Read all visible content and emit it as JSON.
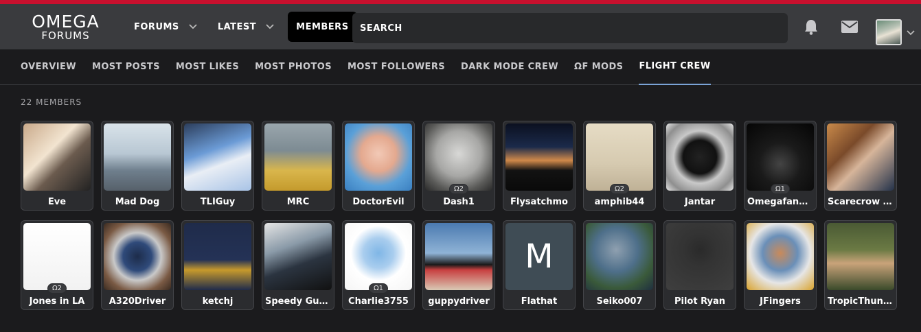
{
  "logo": {
    "line1": "OMEGA",
    "line2": "FORUMS"
  },
  "nav": [
    {
      "label": "FORUMS",
      "dropdown": true
    },
    {
      "label": "LATEST",
      "dropdown": true
    },
    {
      "label": "MEMBERS",
      "dropdown": false,
      "active": true
    }
  ],
  "search": {
    "label": "SEARCH"
  },
  "icons": {
    "notifications": "bell-icon",
    "messages": "envelope-icon"
  },
  "subnav": [
    {
      "label": "OVERVIEW"
    },
    {
      "label": "MOST POSTS"
    },
    {
      "label": "MOST LIKES"
    },
    {
      "label": "MOST PHOTOS"
    },
    {
      "label": "MOST FOLLOWERS"
    },
    {
      "label": "DARK MODE CREW"
    },
    {
      "label": "ΩF MODS"
    },
    {
      "label": "FLIGHT CREW",
      "active": true
    }
  ],
  "member_count": "22 MEMBERS",
  "colors": {
    "accent": "#c8102e",
    "topbar": "#3a3b3e",
    "background": "#1b1b1d",
    "active_tab_underline": "#7aa3d6"
  },
  "members": [
    {
      "name": "Eve",
      "badge": "",
      "bg": "linear-gradient(135deg,#c9a98a 0%,#f2e4d0 40%,#6b5b4e 60%,#222 100%)"
    },
    {
      "name": "Mad Dog",
      "badge": "",
      "bg": "linear-gradient(180deg,#d9e3ea 0%,#b8c7d3 45%,#6f7f8d 70%,#56606a 100%)"
    },
    {
      "name": "TLIGuy",
      "badge": "",
      "bg": "linear-gradient(160deg,#2c3e5c 0%,#6b9bd6 40%,#e9eef5 60%,#a8c3e6 100%)"
    },
    {
      "name": "MRC",
      "badge": "",
      "bg": "linear-gradient(180deg,#9aa6ad 0%,#7d8b93 40%,#d9b64c 70%,#c49a2c 100%)"
    },
    {
      "name": "DoctorEvil",
      "badge": "",
      "bg": "radial-gradient(circle at 50% 45%,#f2c9b6 0%,#e4a98f 35%,#5aa0d8 65%,#3a7fc0 100%)"
    },
    {
      "name": "Dash1",
      "badge": "Ω2",
      "bg": "radial-gradient(circle at 50% 45%,#d8d8d6 0%,#a7a7a5 45%,#5a5a58 75%,#2a2a2a 100%)"
    },
    {
      "name": "Flysatchmo",
      "badge": "",
      "bg": "linear-gradient(180deg,#0b1020 0%,#1b2a4a 35%,#d0894a 55%,#121212 70%,#0a0a0a 100%)"
    },
    {
      "name": "amphib44",
      "badge": "Ω2",
      "bg": "linear-gradient(180deg,#e6dcc5 0%,#d6cab0 60%,#bfb196 100%)"
    },
    {
      "name": "Jantar",
      "badge": "",
      "bg": "radial-gradient(circle at 50% 50%,#222 0%,#111 35%,#c9c9c9 55%,#8f8f8f 80%,#e5e5e5 100%)"
    },
    {
      "name": "Omegafanm...",
      "badge": "Ω1",
      "bg": "radial-gradient(circle at 50% 60%,#444 0%,#1a1a1a 40%,#050505 100%)"
    },
    {
      "name": "Scarecrow B...",
      "badge": "",
      "bg": "linear-gradient(135deg,#c98a4a 0%,#7a4a2a 35%,#d7b59a 55%,#24324a 100%)"
    },
    {
      "name": "Jones in LA",
      "badge": "Ω2",
      "bg": "linear-gradient(180deg,#ffffff 0%,#f2f2f2 100%)"
    },
    {
      "name": "A320Driver",
      "badge": "",
      "bg": "radial-gradient(circle at 50% 50%,#1d2c4a 0%,#2f4a7a 30%,#c9c9c9 50%,#7a5a44 75%,#3a2a20 100%)"
    },
    {
      "name": "ketchj",
      "badge": "",
      "bg": "linear-gradient(180deg,#1f2b4a 0%,#243256 55%,#c79a2c 70%,#1f2b4a 100%)"
    },
    {
      "name": "Speedy Gup...",
      "badge": "",
      "bg": "linear-gradient(160deg,#e5e5e5 0%,#8a9aa8 35%,#2b3440 60%,#111 100%)"
    },
    {
      "name": "Charlie3755",
      "badge": "Ω1",
      "bg": "radial-gradient(circle at 50% 45%,#7fb6e6 0%,#a9cdee 30%,#ffffff 55%,#f5f5f5 100%)"
    },
    {
      "name": "guppydriver",
      "badge": "",
      "bg": "linear-gradient(180deg,#4b7ab0 0%,#8fb3d6 45%,#1a1a1a 62%,#c84040 70%,#d9c9b5 100%)"
    },
    {
      "name": "Flathat",
      "badge": "",
      "letter": "M",
      "bg": "#3f4c55"
    },
    {
      "name": "Seiko007",
      "badge": "",
      "bg": "radial-gradient(circle at 45% 40%,#8fa0b0 0%,#4e6f8a 40%,#3a5a3a 70%,#1f2f40 100%)"
    },
    {
      "name": "Pilot Ryan",
      "badge": "",
      "bg": "radial-gradient(circle at 50% 40%,#2a2a2a 0%,#333 30%,#3f3f3f 100%)"
    },
    {
      "name": "JFingers",
      "badge": "",
      "bg": "radial-gradient(circle at 50% 45%,#c98a5a 0%,#6a8fb8 35%,#e6e6e6 60%,#d9a22c 100%)"
    },
    {
      "name": "TropicThunder",
      "badge": "",
      "bg": "linear-gradient(180deg,#4a5a34 0%,#6b7a44 40%,#c9a37a 60%,#3a4a2a 100%)"
    }
  ]
}
